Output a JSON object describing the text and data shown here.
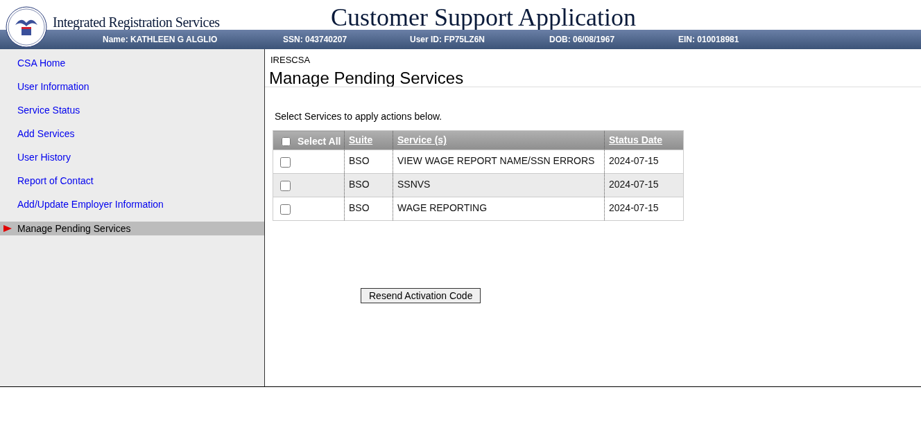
{
  "header": {
    "subtitle": "Integrated Registration Services",
    "title": "Customer Support Application"
  },
  "user_bar": [
    {
      "text": "Name: KATHLEEN G ALGLIO"
    },
    {
      "text": "SSN: 043740207"
    },
    {
      "text": "User ID: FP75LZ6N"
    },
    {
      "text": "DOB: 06/08/1967"
    },
    {
      "text": "EIN: 010018981"
    }
  ],
  "sidebar": {
    "items": [
      {
        "label": "CSA Home",
        "selected": false
      },
      {
        "label": "User Information",
        "selected": false
      },
      {
        "label": "Service Status",
        "selected": false
      },
      {
        "label": "Add Services",
        "selected": false
      },
      {
        "label": "User History",
        "selected": false
      },
      {
        "label": "Report of Contact",
        "selected": false
      },
      {
        "label": "Add/Update Employer Information",
        "selected": false
      },
      {
        "label": "Manage Pending Services",
        "selected": true
      }
    ]
  },
  "main": {
    "breadcrumb": "IRESCSA",
    "heading": "Manage Pending Services",
    "instruction": "Select Services to apply actions below.",
    "table": {
      "select_all": {
        "label": "Select All",
        "checked": false
      },
      "columns": [
        "Suite",
        "Service (s)",
        "Status Date"
      ],
      "rows": [
        {
          "checked": false,
          "cells": [
            "BSO",
            "VIEW WAGE REPORT NAME/SSN ERRORS",
            "2024-07-15"
          ]
        },
        {
          "checked": false,
          "cells": [
            "BSO",
            "SSNVS",
            "2024-07-15"
          ]
        },
        {
          "checked": false,
          "cells": [
            "BSO",
            "WAGE REPORTING",
            "2024-07-15"
          ]
        }
      ]
    },
    "button": "Resend Activation Code"
  }
}
